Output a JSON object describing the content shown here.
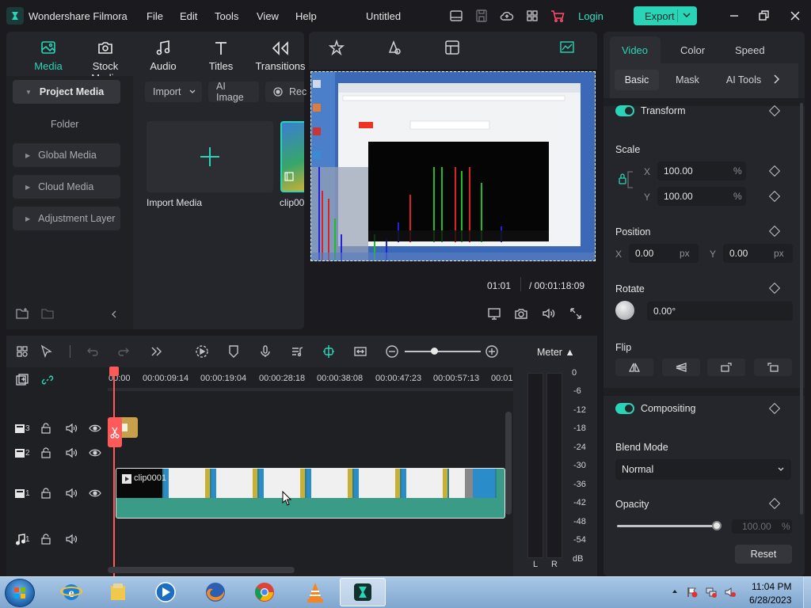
{
  "app": {
    "name": "Wondershare Filmora",
    "document_title": "Untitled",
    "menu": [
      "File",
      "Edit",
      "Tools",
      "View",
      "Help"
    ],
    "login_label": "Login",
    "export_label": "Export"
  },
  "media_panel": {
    "tabs": [
      {
        "label": "Media",
        "icon": "media-icon",
        "active": true
      },
      {
        "label": "Stock Media",
        "icon": "stock-media-icon",
        "active": false
      },
      {
        "label": "Audio",
        "icon": "music-note-icon",
        "active": false
      },
      {
        "label": "Titles",
        "icon": "text-t-icon",
        "active": false
      },
      {
        "label": "Transitions",
        "icon": "transitions-icon",
        "active": false
      }
    ],
    "sidebar": {
      "project_media": "Project Media",
      "folder": "Folder",
      "global_media": "Global Media",
      "cloud_media": "Cloud Media",
      "adjustment_layer": "Adjustment Layer"
    },
    "buttons": {
      "import": "Import",
      "ai_image": "AI Image",
      "record": "Rec"
    },
    "import_tile_label": "Import Media",
    "clip_label": "clip00"
  },
  "preview": {
    "tabs_partial": [
      "Effects",
      "Stickers",
      "Templates"
    ],
    "time_current": "01:01",
    "time_total": "/   00:01:18:09"
  },
  "inspector": {
    "tabs": [
      "Video",
      "Color",
      "Speed"
    ],
    "active_tab": "Video",
    "subtabs": [
      "Basic",
      "Mask",
      "AI Tools"
    ],
    "active_subtab": "Basic",
    "transform": {
      "label": "Transform",
      "enabled": true,
      "scale_label": "Scale",
      "scale_x_label": "X",
      "scale_x": "100.00",
      "scale_y_label": "Y",
      "scale_y": "100.00",
      "percent": "%",
      "position_label": "Position",
      "pos_x_label": "X",
      "pos_x": "0.00",
      "pos_y_label": "Y",
      "pos_y": "0.00",
      "px": "px",
      "rotate_label": "Rotate",
      "rotate_value": "0.00°",
      "flip_label": "Flip"
    },
    "compositing": {
      "label": "Compositing",
      "enabled": true,
      "blend_mode_label": "Blend Mode",
      "blend_mode": "Normal",
      "opacity_label": "Opacity",
      "opacity_value": "100.00",
      "opacity_unit": "%",
      "opacity_fraction": 1.0
    },
    "reset_label": "Reset"
  },
  "timeline": {
    "ruler": [
      "00:00",
      "00:00:09:14",
      "00:00:19:04",
      "00:00:28:18",
      "00:00:38:08",
      "00:00:47:23",
      "00:00:57:13",
      "00:01:"
    ],
    "tracks": [
      {
        "num": "3",
        "type": "video"
      },
      {
        "num": "2",
        "type": "video"
      },
      {
        "num": "1",
        "type": "video"
      },
      {
        "num": "1",
        "type": "audio"
      }
    ],
    "clip_name": "clip0001"
  },
  "meter": {
    "label": "Meter ▲",
    "scale": [
      "0",
      "-6",
      "-12",
      "-18",
      "-24",
      "-30",
      "-36",
      "-42",
      "-48",
      "-54",
      "dB"
    ],
    "channels": [
      "L",
      "R"
    ]
  },
  "taskbar": {
    "time": "11:04 PM",
    "date": "6/28/2023",
    "apps": [
      "internet-explorer",
      "file-explorer",
      "windows-media-player",
      "firefox",
      "chrome",
      "vlc",
      "filmora"
    ]
  },
  "colors": {
    "accent": "#2ad4b6",
    "playhead": "#ff5a5a",
    "background": "#1b1b1f",
    "panel": "#25262b"
  }
}
